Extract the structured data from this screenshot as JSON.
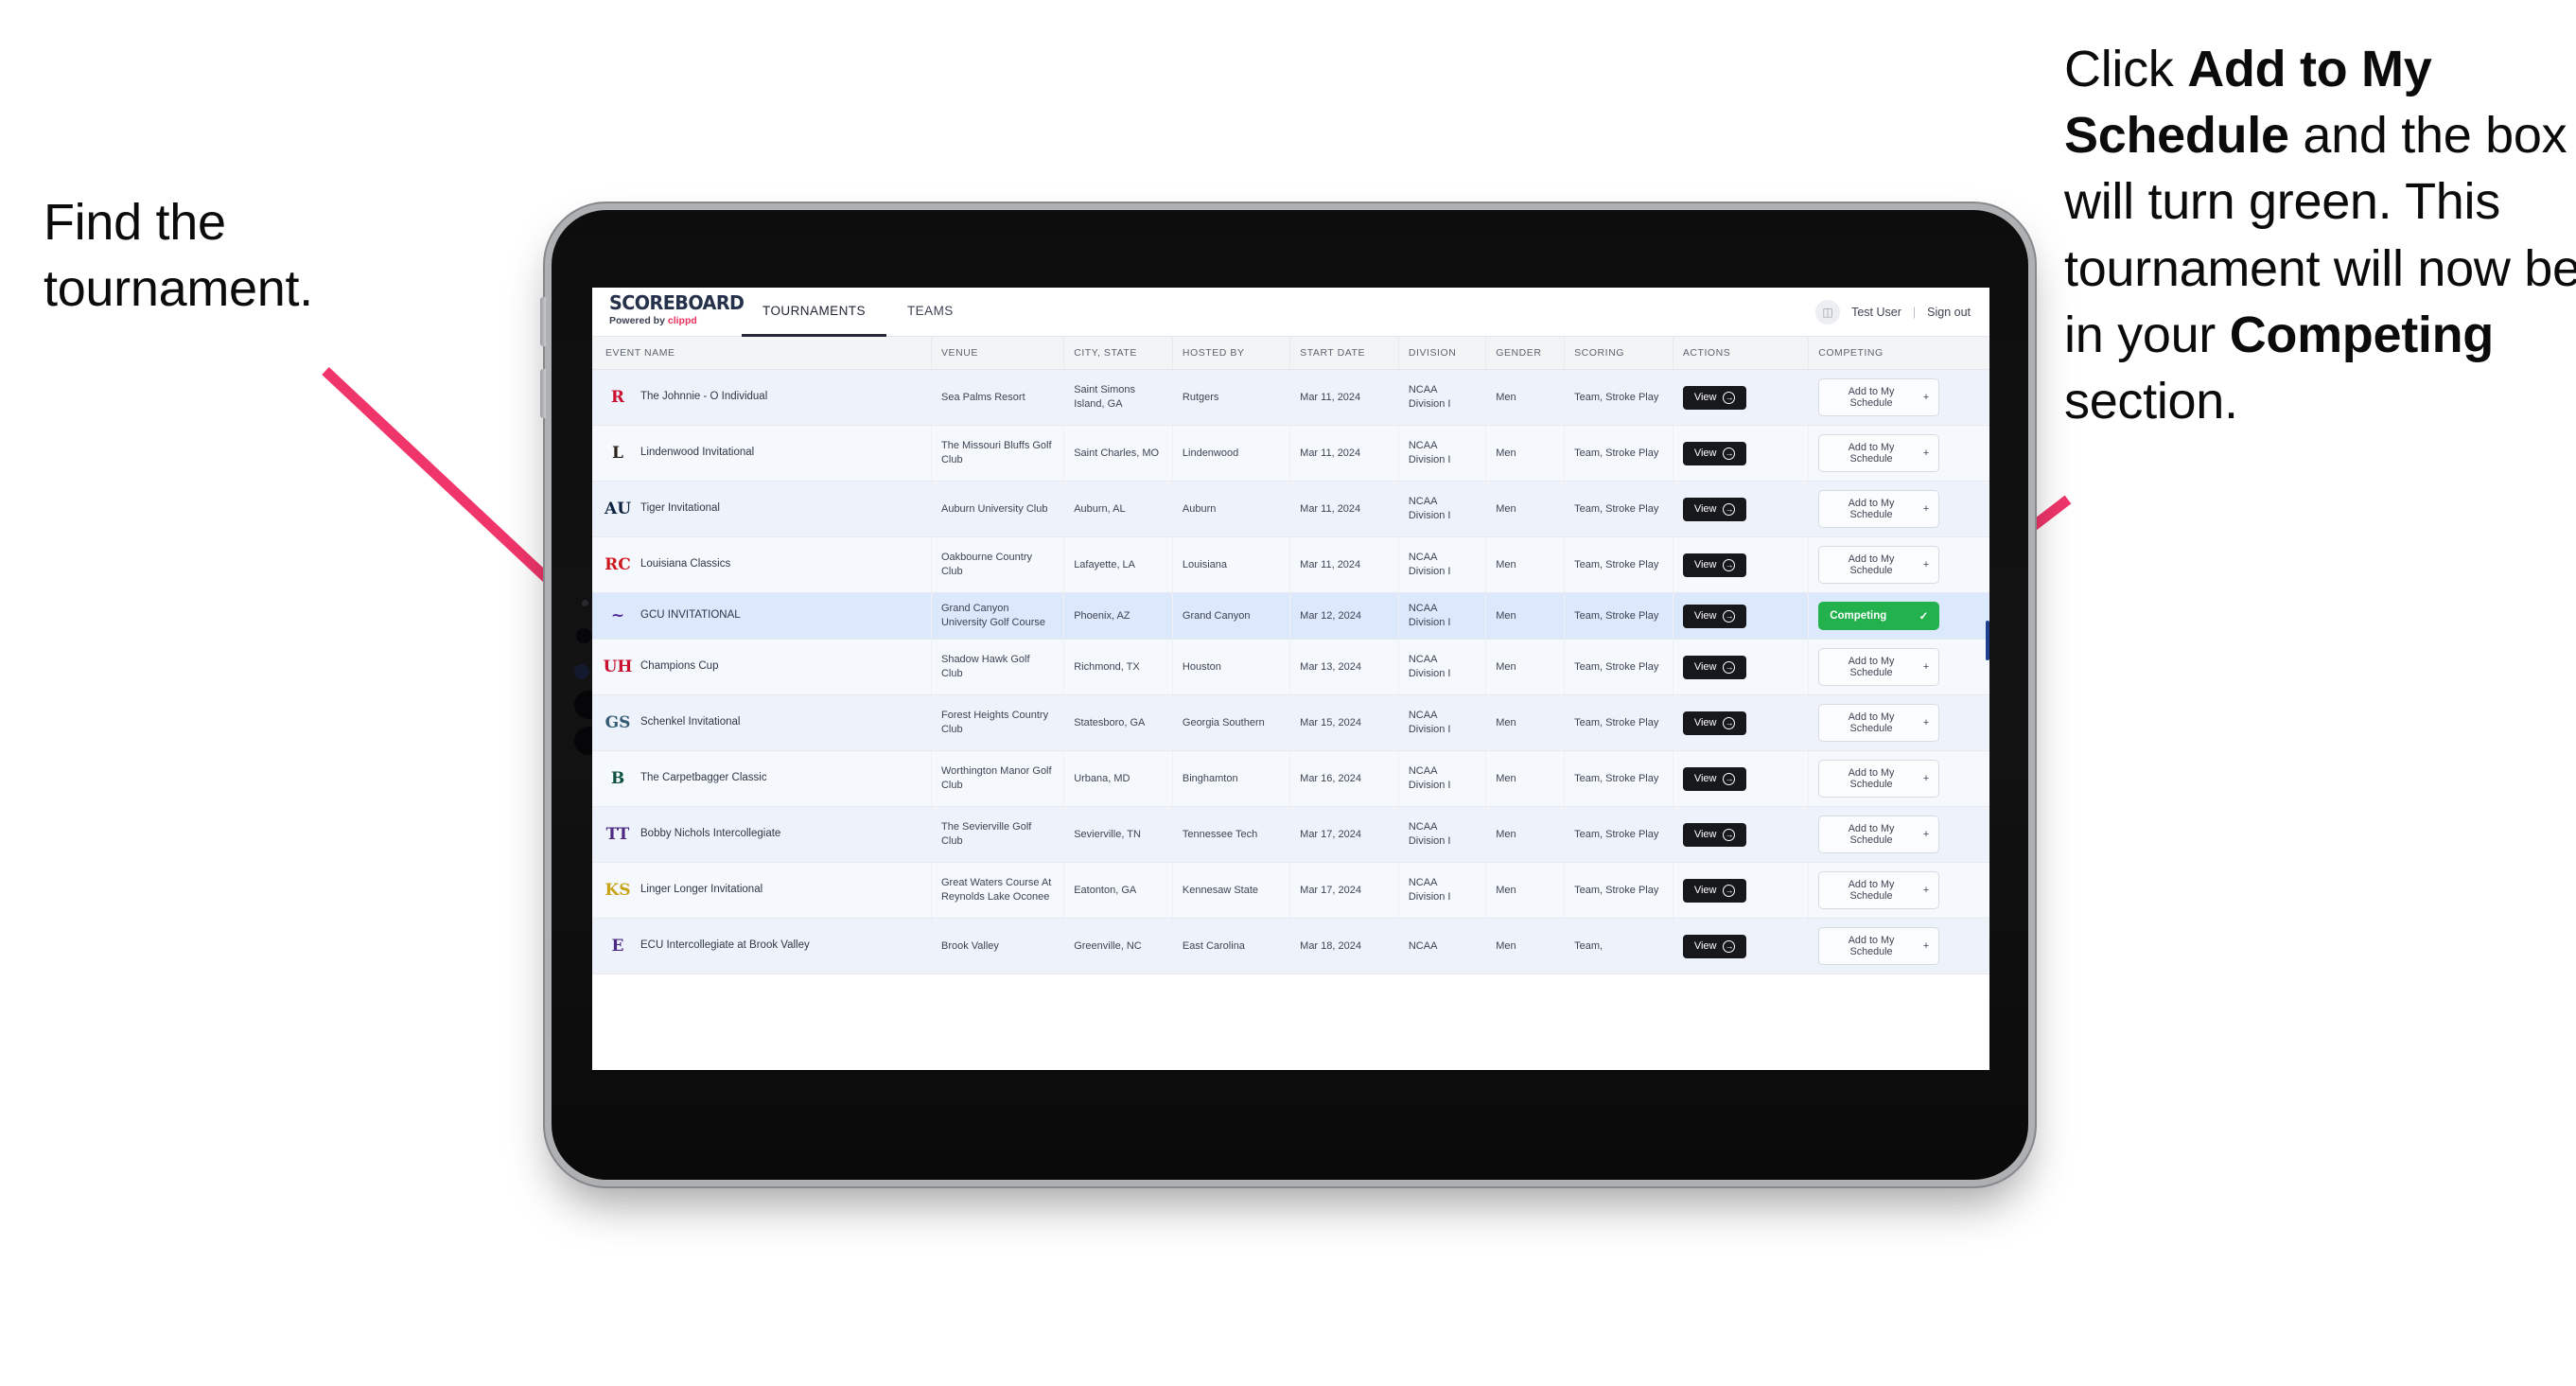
{
  "annotations": {
    "left": "Find the tournament.",
    "right_parts": [
      {
        "text": "Click ",
        "bold": false
      },
      {
        "text": "Add to My Schedule",
        "bold": true
      },
      {
        "text": " and the box will turn green. This tournament will now be in your ",
        "bold": false
      },
      {
        "text": "Competing",
        "bold": true
      },
      {
        "text": " section.",
        "bold": false
      }
    ],
    "arrow_color": "#f0356a"
  },
  "app": {
    "brand": {
      "title": "SCOREBOARD",
      "powered_prefix": "Powered by ",
      "powered_brand": "clippd"
    },
    "nav": [
      {
        "label": "TOURNAMENTS",
        "active": true
      },
      {
        "label": "TEAMS",
        "active": false
      }
    ],
    "account": {
      "avatar_icon": "user-avatar-icon",
      "user": "Test User",
      "separator": "|",
      "signout": "Sign out"
    }
  },
  "table": {
    "columns": [
      "EVENT NAME",
      "VENUE",
      "CITY, STATE",
      "HOSTED BY",
      "START DATE",
      "DIVISION",
      "GENDER",
      "SCORING",
      "ACTIONS",
      "COMPETING"
    ],
    "view_label": "View",
    "add_label": "Add to My Schedule",
    "add_icon": "plus-icon",
    "competing_label": "Competing",
    "competing_icon": "check-icon",
    "rows": [
      {
        "event": "The Johnnie - O Individual",
        "logo_text": "R",
        "logo_color": "#c8102e",
        "venue": "Sea Palms Resort",
        "city": "Saint Simons Island, GA",
        "host": "Rutgers",
        "date": "Mar 11, 2024",
        "division": "NCAA Division I",
        "gender": "Men",
        "scoring": "Team, Stroke Play",
        "competing": false
      },
      {
        "event": "Lindenwood Invitational",
        "logo_text": "L",
        "logo_color": "#2a2118",
        "venue": "The Missouri Bluffs Golf Club",
        "city": "Saint Charles, MO",
        "host": "Lindenwood",
        "date": "Mar 11, 2024",
        "division": "NCAA Division I",
        "gender": "Men",
        "scoring": "Team, Stroke Play",
        "competing": false
      },
      {
        "event": "Tiger Invitational",
        "logo_text": "AU",
        "logo_color": "#0c2340",
        "venue": "Auburn University Club",
        "city": "Auburn, AL",
        "host": "Auburn",
        "date": "Mar 11, 2024",
        "division": "NCAA Division I",
        "gender": "Men",
        "scoring": "Team, Stroke Play",
        "competing": false
      },
      {
        "event": "Louisiana Classics",
        "logo_text": "RC",
        "logo_color": "#ce181e",
        "venue": "Oakbourne Country Club",
        "city": "Lafayette, LA",
        "host": "Louisiana",
        "date": "Mar 11, 2024",
        "division": "NCAA Division I",
        "gender": "Men",
        "scoring": "Team, Stroke Play",
        "competing": false
      },
      {
        "event": "GCU INVITATIONAL",
        "logo_text": "~",
        "logo_color": "#522398",
        "venue": "Grand Canyon University Golf Course",
        "city": "Phoenix, AZ",
        "host": "Grand Canyon",
        "date": "Mar 12, 2024",
        "division": "NCAA Division I",
        "gender": "Men",
        "scoring": "Team, Stroke Play",
        "competing": true,
        "selected": true
      },
      {
        "event": "Champions Cup",
        "logo_text": "UH",
        "logo_color": "#c8102e",
        "venue": "Shadow Hawk Golf Club",
        "city": "Richmond, TX",
        "host": "Houston",
        "date": "Mar 13, 2024",
        "division": "NCAA Division I",
        "gender": "Men",
        "scoring": "Team, Stroke Play",
        "competing": false
      },
      {
        "event": "Schenkel Invitational",
        "logo_text": "GS",
        "logo_color": "#335b74",
        "venue": "Forest Heights Country Club",
        "city": "Statesboro, GA",
        "host": "Georgia Southern",
        "date": "Mar 15, 2024",
        "division": "NCAA Division I",
        "gender": "Men",
        "scoring": "Team, Stroke Play",
        "competing": false
      },
      {
        "event": "The Carpetbagger Classic",
        "logo_text": "B",
        "logo_color": "#0d513f",
        "venue": "Worthington Manor Golf Club",
        "city": "Urbana, MD",
        "host": "Binghamton",
        "date": "Mar 16, 2024",
        "division": "NCAA Division I",
        "gender": "Men",
        "scoring": "Team, Stroke Play",
        "competing": false
      },
      {
        "event": "Bobby Nichols Intercollegiate",
        "logo_text": "TT",
        "logo_color": "#4e2a84",
        "venue": "The Sevierville Golf Club",
        "city": "Sevierville, TN",
        "host": "Tennessee Tech",
        "date": "Mar 17, 2024",
        "division": "NCAA Division I",
        "gender": "Men",
        "scoring": "Team, Stroke Play",
        "competing": false
      },
      {
        "event": "Linger Longer Invitational",
        "logo_text": "KS",
        "logo_color": "#c8a415",
        "venue": "Great Waters Course At Reynolds Lake Oconee",
        "city": "Eatonton, GA",
        "host": "Kennesaw State",
        "date": "Mar 17, 2024",
        "division": "NCAA Division I",
        "gender": "Men",
        "scoring": "Team, Stroke Play",
        "competing": false
      },
      {
        "event": "ECU Intercollegiate at Brook Valley",
        "logo_text": "E",
        "logo_color": "#4e2a84",
        "venue": "Brook Valley",
        "city": "Greenville, NC",
        "host": "East Carolina",
        "date": "Mar 18, 2024",
        "division": "NCAA",
        "gender": "Men",
        "scoring": "Team,",
        "competing": false,
        "partial": true
      }
    ]
  }
}
